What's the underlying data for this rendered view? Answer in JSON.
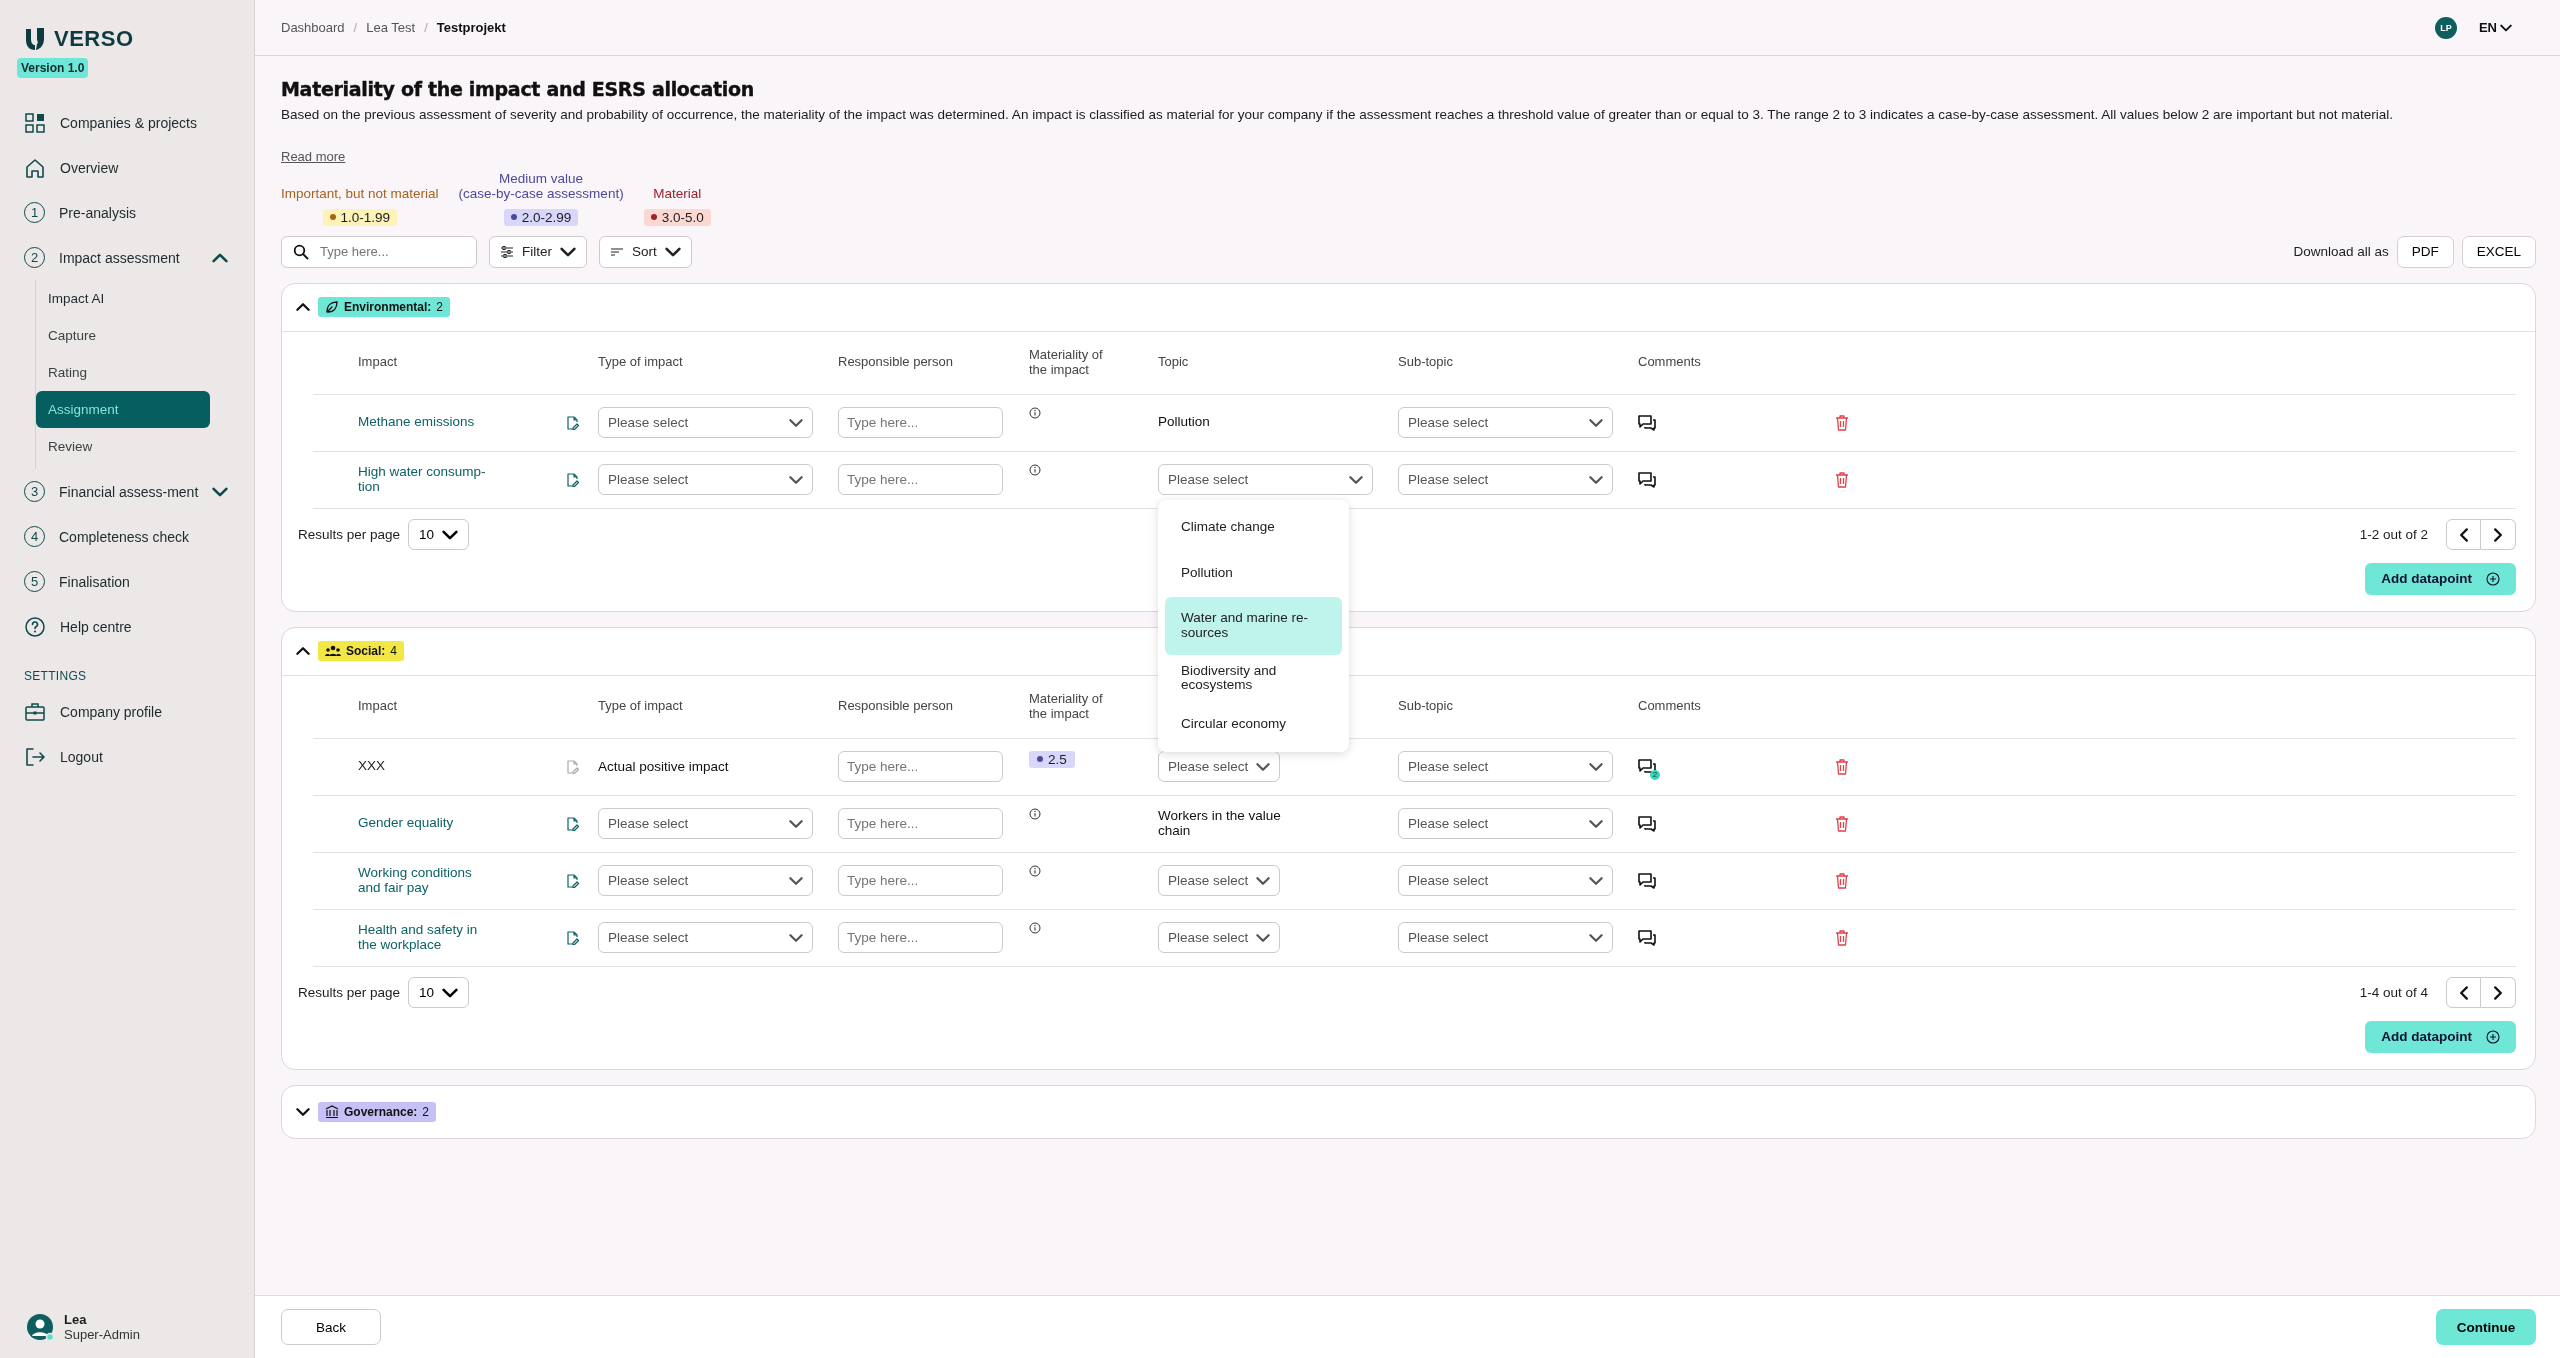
{
  "sidebar": {
    "logo": "VERSO",
    "version": "Version 1.0",
    "items": [
      {
        "kind": "grid",
        "label": "Companies & projects",
        "selected": false
      },
      {
        "kind": "home",
        "label": "Overview",
        "selected": false
      },
      {
        "kind": "step",
        "number": "1",
        "label": "Pre-analysis",
        "selected": false
      },
      {
        "kind": "step",
        "number": "2",
        "label": "Impact assessment",
        "selected": false,
        "expanded": true,
        "children": [
          {
            "label": "Impact AI",
            "selected": false
          },
          {
            "label": "Capture",
            "selected": false
          },
          {
            "label": "Rating",
            "selected": false
          },
          {
            "label": "Assignment",
            "selected": true
          },
          {
            "label": "Review",
            "selected": false
          }
        ]
      },
      {
        "kind": "step",
        "number": "3",
        "label": "Financial assess-ment",
        "selected": false,
        "expanded": false
      },
      {
        "kind": "step",
        "number": "4",
        "label": "Completeness check",
        "selected": false
      },
      {
        "kind": "step",
        "number": "5",
        "label": "Finalisation",
        "selected": false
      },
      {
        "kind": "help",
        "label": "Help centre",
        "selected": false
      }
    ],
    "settings_heading": "SETTINGS",
    "settings_items": [
      {
        "kind": "briefcase",
        "label": "Company profile",
        "selected": false
      },
      {
        "kind": "logout",
        "label": "Logout",
        "selected": false
      }
    ],
    "user": {
      "name": "Lea",
      "role": "Super-Admin"
    }
  },
  "breadcrumb": [
    {
      "kind": "link",
      "text": "Dashboard"
    },
    {
      "kind": "separator",
      "text": "/"
    },
    {
      "kind": "link",
      "text": "Lea Test"
    },
    {
      "kind": "separator",
      "text": "/"
    },
    {
      "kind": "current",
      "text": "Testprojekt"
    }
  ],
  "header": {
    "avatar": "LP",
    "language": "EN"
  },
  "title": "Materiality of the impact and ESRS allocation",
  "description": "Based on the previous assessment of severity and probability of occurrence, the materiality of the impact was determined. An impact is classified as material for your company if the assessment reaches a threshold value of greater than or equal to 3. The range 2 to 3 indicates a case-by-case assessment. All values below 2 are important but not material.",
  "read_more": "Read more",
  "legend": [
    {
      "label": "Important, but not material",
      "range": "1.0-1.99",
      "color": "#a8621a"
    },
    {
      "label": "Medium value\n(case-by-case assessment)",
      "range": "2.0-2.99",
      "color": "#4b4a9c"
    },
    {
      "label": "Material",
      "range": "3.0-5.0",
      "color": "#a3202a"
    }
  ],
  "toolbar": {
    "search": {
      "placeholder": "Type here..."
    },
    "filter": "Filter",
    "sort": "Sort",
    "download_label": "Download all as",
    "downloads": [
      "PDF",
      "EXCEL"
    ]
  },
  "sections": [
    {
      "kind": "environmental",
      "label": "Environmental:",
      "count": "2",
      "color": "#6ee7d6",
      "expanded": true,
      "columns": [
        "Impact",
        "Type of impact",
        "Responsible person",
        "Materiality of\nthe impact",
        "Topic",
        "Sub-topic",
        "Comments"
      ],
      "rows": [
        {
          "impact": "Methane emissions",
          "linked": true,
          "type": {
            "kind": "select",
            "text": "Please select"
          },
          "responsible": {
            "placeholder": "Type here..."
          },
          "materiality": {
            "kind": "info"
          },
          "topic": {
            "kind": "text",
            "text": "Pollution"
          },
          "subtopic": "Please select"
        },
        {
          "impact": "High water consump-tion",
          "linked": true,
          "type": {
            "kind": "select",
            "text": "Please select"
          },
          "responsible": {
            "placeholder": "Type here..."
          },
          "materiality": {
            "kind": "info"
          },
          "topic": {
            "kind": "select",
            "text": "Please select",
            "open": true,
            "options": [
              {
                "label": "Climate change",
                "selected": false
              },
              {
                "label": "Pollution",
                "selected": false
              },
              {
                "label": "Water and marine re-sources",
                "selected": true
              },
              {
                "label": "Biodiversity and ecosystems",
                "selected": false
              },
              {
                "label": "Circular economy",
                "selected": false
              }
            ]
          },
          "subtopic": "Please select"
        }
      ],
      "results_label": "Results per page",
      "page_size": "10",
      "range": "1-2 out of 2",
      "add_button": "Add datapoint"
    },
    {
      "kind": "social",
      "label": "Social:",
      "count": "4",
      "color": "#f2e743",
      "expanded": true,
      "columns": [
        "Impact",
        "Type of impact",
        "Responsible person",
        "Materiality of\nthe impact",
        null,
        "Sub-topic",
        "Comments"
      ],
      "rows": [
        {
          "impact": "XXX",
          "linked": false,
          "type": {
            "kind": "text",
            "text": "Actual positive impact"
          },
          "responsible": {
            "placeholder": "Type here..."
          },
          "materiality": {
            "kind": "badge",
            "text": "2.5",
            "color": "#4b4a9c"
          },
          "topic": {
            "kind": "compact",
            "text": "Please select"
          },
          "subtopic": "Please select",
          "comment_count": "2"
        },
        {
          "impact": "Gender equality",
          "linked": true,
          "type": {
            "kind": "select",
            "text": "Please select"
          },
          "responsible": {
            "placeholder": "Type here..."
          },
          "materiality": {
            "kind": "info"
          },
          "topic": {
            "kind": "text",
            "text": "Workers in the value chain"
          },
          "subtopic": "Please select"
        },
        {
          "impact": "Working conditions and fair pay",
          "linked": true,
          "type": {
            "kind": "select",
            "text": "Please select"
          },
          "responsible": {
            "placeholder": "Type here..."
          },
          "materiality": {
            "kind": "info"
          },
          "topic": {
            "kind": "compact",
            "text": "Please select"
          },
          "subtopic": "Please select"
        },
        {
          "impact": "Health and safety in the workplace",
          "linked": true,
          "type": {
            "kind": "select",
            "text": "Please select"
          },
          "responsible": {
            "placeholder": "Type here..."
          },
          "materiality": {
            "kind": "info"
          },
          "topic": {
            "kind": "compact",
            "text": "Please select"
          },
          "subtopic": "Please select"
        }
      ],
      "results_label": "Results per page",
      "page_size": "10",
      "range": "1-4 out of 4",
      "add_button": "Add datapoint"
    },
    {
      "kind": "governance",
      "label": "Governance:",
      "count": "2",
      "color": "#c5c1f6",
      "expanded": false
    }
  ],
  "buttons": {
    "back": "Back",
    "continue": "Continue"
  }
}
